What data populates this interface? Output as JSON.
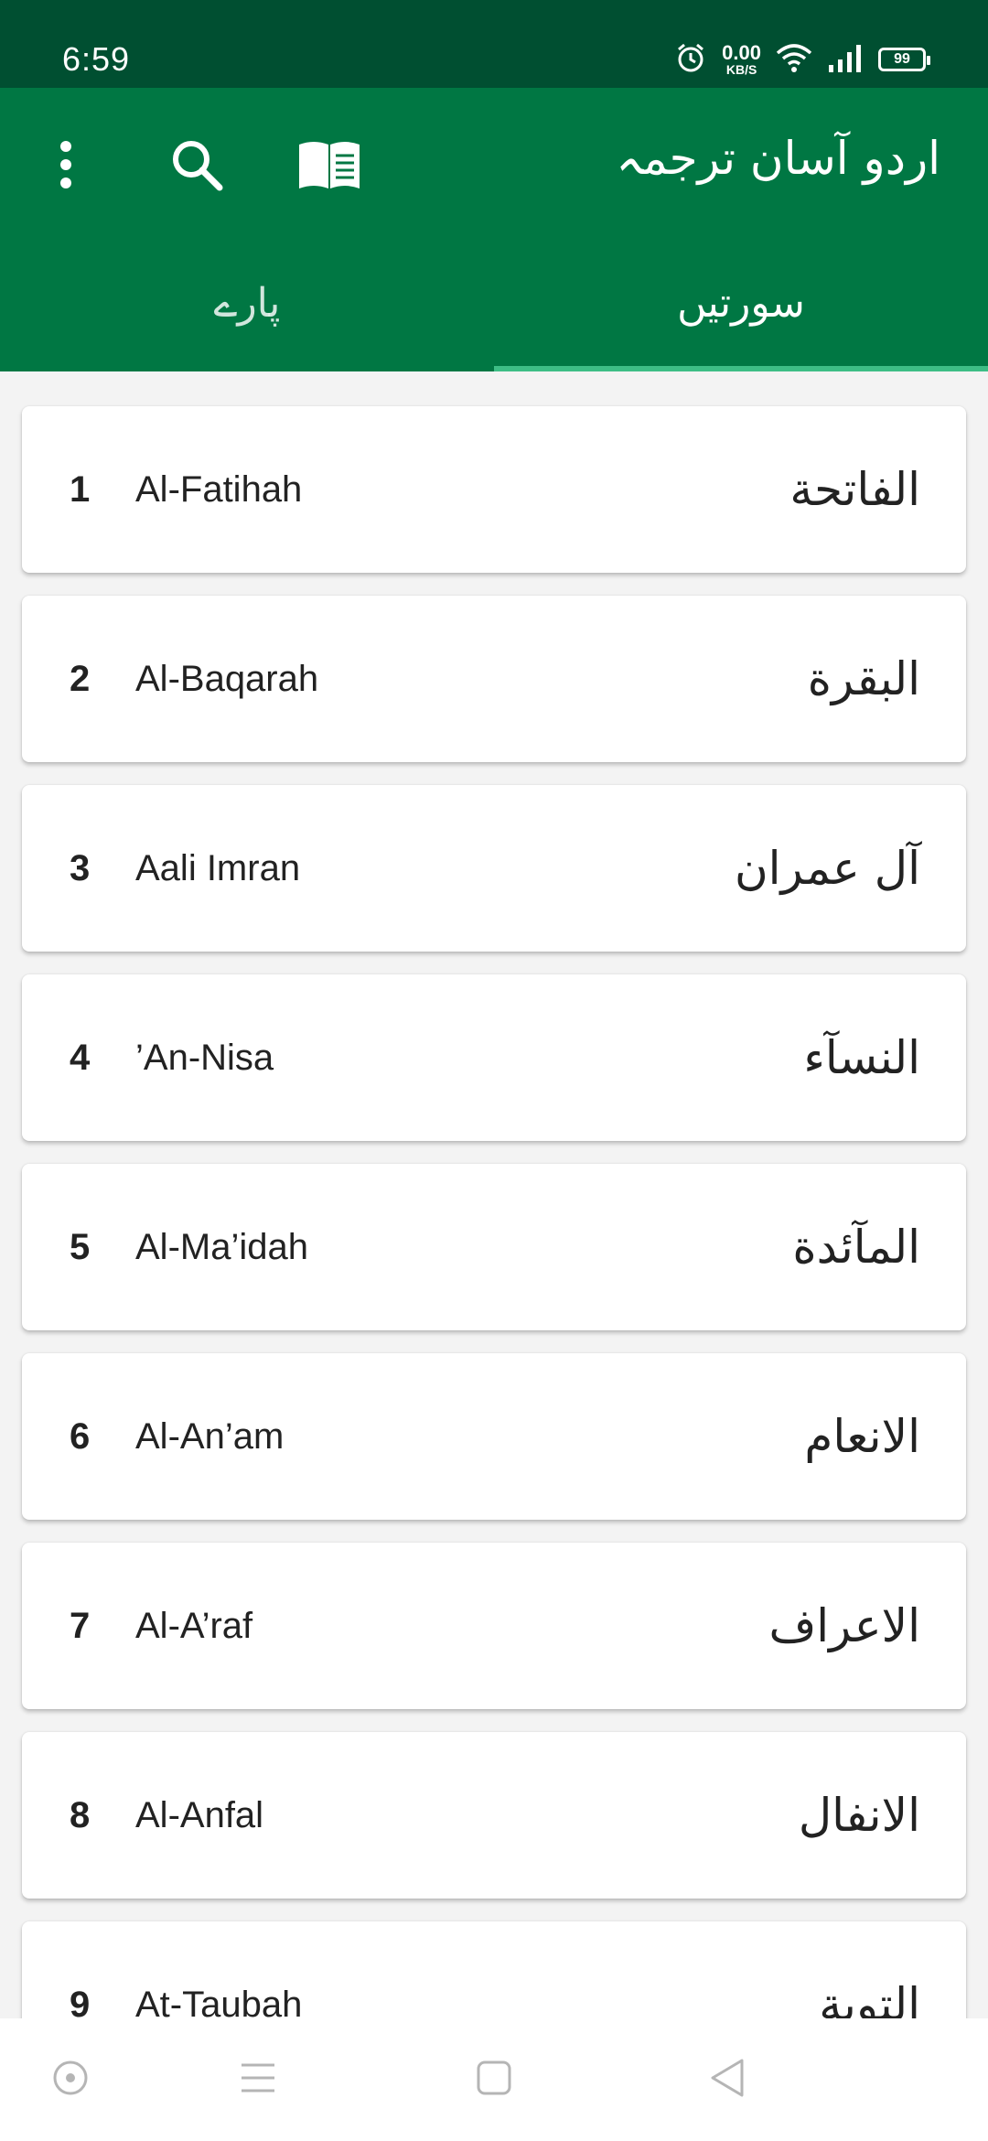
{
  "status_bar": {
    "time": "6:59",
    "net_speed_value": "0.00",
    "net_speed_unit": "KB/S",
    "battery": "99",
    "icons": [
      "alarm-icon",
      "wifi-icon",
      "signal-icon",
      "battery-icon"
    ]
  },
  "app_bar": {
    "title": "اردو آسان ترجمہ",
    "actions": [
      "more-vert-icon",
      "search-icon",
      "book-icon"
    ],
    "color": "#007743"
  },
  "tabs": [
    {
      "label": "پارے",
      "selected": false
    },
    {
      "label": "سورتیں",
      "selected": true
    }
  ],
  "surahs": [
    {
      "number": "1",
      "name": "Al-Fatihah",
      "arabic": "الفاتحة"
    },
    {
      "number": "2",
      "name": "Al-Baqarah",
      "arabic": "البقرة"
    },
    {
      "number": "3",
      "name": "Aali Imran",
      "arabic": "آل عمران"
    },
    {
      "number": "4",
      "name": "’An-Nisa",
      "arabic": "النسآء"
    },
    {
      "number": "5",
      "name": "Al-Ma’idah",
      "arabic": "المآئدة"
    },
    {
      "number": "6",
      "name": "Al-An’am",
      "arabic": "الانعام"
    },
    {
      "number": "7",
      "name": "Al-A’raf",
      "arabic": "الاعراف"
    },
    {
      "number": "8",
      "name": "Al-Anfal",
      "arabic": "الانفال"
    },
    {
      "number": "9",
      "name": "At-Taubah",
      "arabic": "التوبة"
    }
  ],
  "nav_bar": [
    "assistant-icon",
    "menu-icon",
    "home-square-icon",
    "back-triangle-icon"
  ]
}
